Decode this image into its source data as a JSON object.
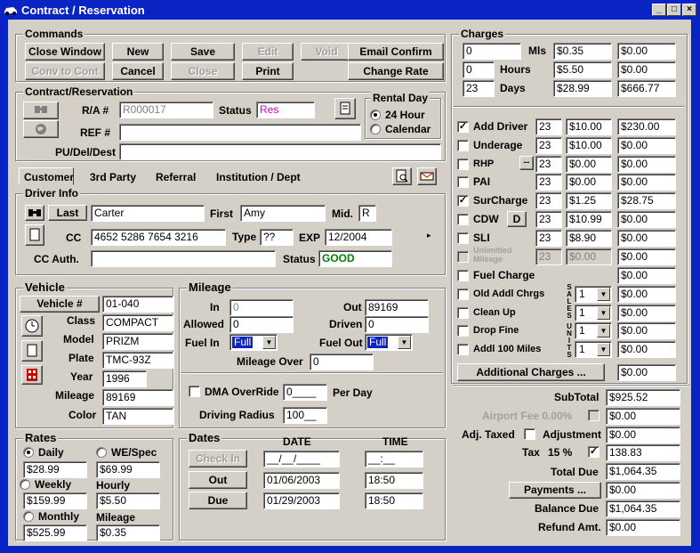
{
  "window": {
    "title": "Contract / Reservation",
    "min": "_",
    "max": "□",
    "close": "×"
  },
  "commands": {
    "label": "Commands",
    "close_window": "Close Window",
    "new": "New",
    "save": "Save",
    "edit": "Edit",
    "void": "Void",
    "email_confirm": "Email Confirm",
    "conv_to_cont": "Conv to Cont",
    "cancel": "Cancel",
    "close": "Close",
    "print": "Print",
    "change_rate": "Change Rate"
  },
  "contract": {
    "label": "Contract/Reservation",
    "ra_label": "R/A #",
    "ra_value": "R000017",
    "status_label": "Status",
    "status_value": "Res",
    "ref_label": "REF #",
    "ref_value": "",
    "pudel_label": "PU/Del/Dest",
    "pudel_value": ""
  },
  "rental_day": {
    "label": "Rental Day",
    "opt1": "24 Hour",
    "opt2": "Calendar"
  },
  "tabs": [
    "Customer",
    "3rd Party",
    "Referral",
    "Institution / Dept"
  ],
  "driver": {
    "label": "Driver Info",
    "last_btn": "Last",
    "last_value": "Carter",
    "first_label": "First",
    "first_value": "Amy",
    "mid_label": "Mid.",
    "mid_value": "R",
    "cc_label": "CC",
    "cc_value": "4652 5286 7654 3216",
    "type_label": "Type",
    "type_value": "??",
    "exp_label": "EXP",
    "exp_value": "12/2004",
    "ccauth_label": "CC Auth.",
    "ccauth_value": "",
    "status_label": "Status",
    "status_value": "GOOD"
  },
  "vehicle": {
    "label": "Vehicle",
    "vehicle_btn": "Vehicle #",
    "vehicle_value": "01-040",
    "class_label": "Class",
    "class_value": "COMPACT",
    "model_label": "Model",
    "model_value": "PRIZM",
    "plate_label": "Plate",
    "plate_value": "TMC-93Z",
    "year_label": "Year",
    "year_value": "1996",
    "mileage_label": "Mileage",
    "mileage_value": "89169",
    "color_label": "Color",
    "color_value": "TAN"
  },
  "mileage": {
    "label": "Mileage",
    "in_label": "In",
    "in_value": "0",
    "out_label": "Out",
    "out_value": "89169",
    "allowed_label": "Allowed",
    "allowed_value": "0",
    "driven_label": "Driven",
    "driven_value": "0",
    "fuelin_label": "Fuel In",
    "fuelin_value": "Full",
    "fuelout_label": "Fuel Out",
    "fuelout_value": "Full",
    "over_label": "Mileage Over",
    "over_value": "0",
    "dma_label": "DMA OverRide",
    "dma_value": "0____",
    "perday_label": "Per Day",
    "radius_label": "Driving Radius",
    "radius_value": "100__"
  },
  "rates": {
    "label": "Rates",
    "daily_label": "Daily",
    "daily_value": "$28.99",
    "wespec_label": "WE/Spec",
    "wespec_value": "$69.99",
    "weekly_label": "Weekly",
    "weekly_value": "$159.99",
    "hourly_label": "Hourly",
    "hourly_value": "$5.50",
    "monthly_label": "Monthly",
    "monthly_value": "$525.99",
    "mileage_label": "Mileage",
    "mileage_value": "$0.35"
  },
  "dates": {
    "label": "Dates",
    "date_hdr": "DATE",
    "time_hdr": "TIME",
    "checkin_btn": "Check In",
    "checkin_date": "__/__/____",
    "checkin_time": "__:__",
    "out_btn": "Out",
    "out_date": "01/06/2003",
    "out_time": "18:50",
    "due_btn": "Due",
    "due_date": "01/29/2003",
    "due_time": "18:50"
  },
  "charges": {
    "label": "Charges",
    "mls": {
      "qty": "0",
      "label": "Mls",
      "rate": "$0.35",
      "amount": "$0.00"
    },
    "hours": {
      "qty": "0",
      "label": "Hours",
      "rate": "$5.50",
      "amount": "$0.00"
    },
    "days": {
      "qty": "23",
      "label": "Days",
      "rate": "$28.99",
      "amount": "$666.77"
    },
    "rows": [
      {
        "label": "Add Driver",
        "checked": "✓",
        "qty": "23",
        "rate": "$10.00",
        "amount": "$230.00"
      },
      {
        "label": "Underage",
        "checked": "",
        "qty": "23",
        "rate": "$10.00",
        "amount": "$0.00"
      },
      {
        "label": "RHP",
        "checked": "",
        "qty": "23",
        "rate": "$0.00",
        "amount": "$0.00"
      },
      {
        "label": "PAI",
        "checked": "",
        "qty": "23",
        "rate": "$0.00",
        "amount": "$0.00"
      },
      {
        "label": "SurCharge",
        "checked": "✓",
        "qty": "23",
        "rate": "$1.25",
        "amount": "$28.75"
      },
      {
        "label": "CDW",
        "checked": "",
        "qty": "23",
        "rate": "$10.99",
        "amount": "$0.00"
      },
      {
        "label": "SLI",
        "checked": "",
        "qty": "23",
        "rate": "$8.90",
        "amount": "$0.00"
      },
      {
        "label": "Unlimitied Mileage",
        "checked": "",
        "qty": "23",
        "rate": "$0.00",
        "amount": "$0.00"
      }
    ],
    "rhp_btn": "--",
    "cdw_btn": "D",
    "fuel": {
      "label": "Fuel Charge",
      "amount": "$0.00"
    },
    "old_addl": {
      "label": "Old Addl Chrgs",
      "qty": "1",
      "amount": "$0.00"
    },
    "cleanup": {
      "label": "Clean Up",
      "qty": "1",
      "amount": "$0.00"
    },
    "dropfine": {
      "label": "Drop Fine",
      "qty": "1",
      "amount": "$0.00"
    },
    "addl100": {
      "label": "Addl 100 Miles",
      "qty": "1",
      "amount": "$0.00"
    },
    "sales_vert": [
      "S",
      "A",
      "L",
      "E",
      "S"
    ],
    "units_vert": [
      "U",
      "N",
      "I",
      "T",
      "S"
    ],
    "additional_btn": "Additional Charges ...",
    "additional_amount": "$0.00"
  },
  "totals": {
    "subtotal_label": "SubTotal",
    "subtotal": "$925.52",
    "airport_label": "Airport Fee 0.00%",
    "airport": "$0.00",
    "adjtaxed_label": "Adj. Taxed",
    "adjustment_label": "Adjustment",
    "adjustment": "$0.00",
    "tax_label": "Tax",
    "tax_pct": "15 %",
    "tax": "138.83",
    "totaldue_label": "Total Due",
    "totaldue": "$1,064.35",
    "payments_btn": "Payments ...",
    "payments": "$0.00",
    "balance_label": "Balance Due",
    "balance": "$1,064.35",
    "refund_label": "Refund Amt.",
    "refund": "$0.00"
  },
  "colors": {
    "title_bar": "#0a24c4",
    "face": "#d4d0c8",
    "status_res": "#d000d0",
    "status_good": "#008000"
  }
}
